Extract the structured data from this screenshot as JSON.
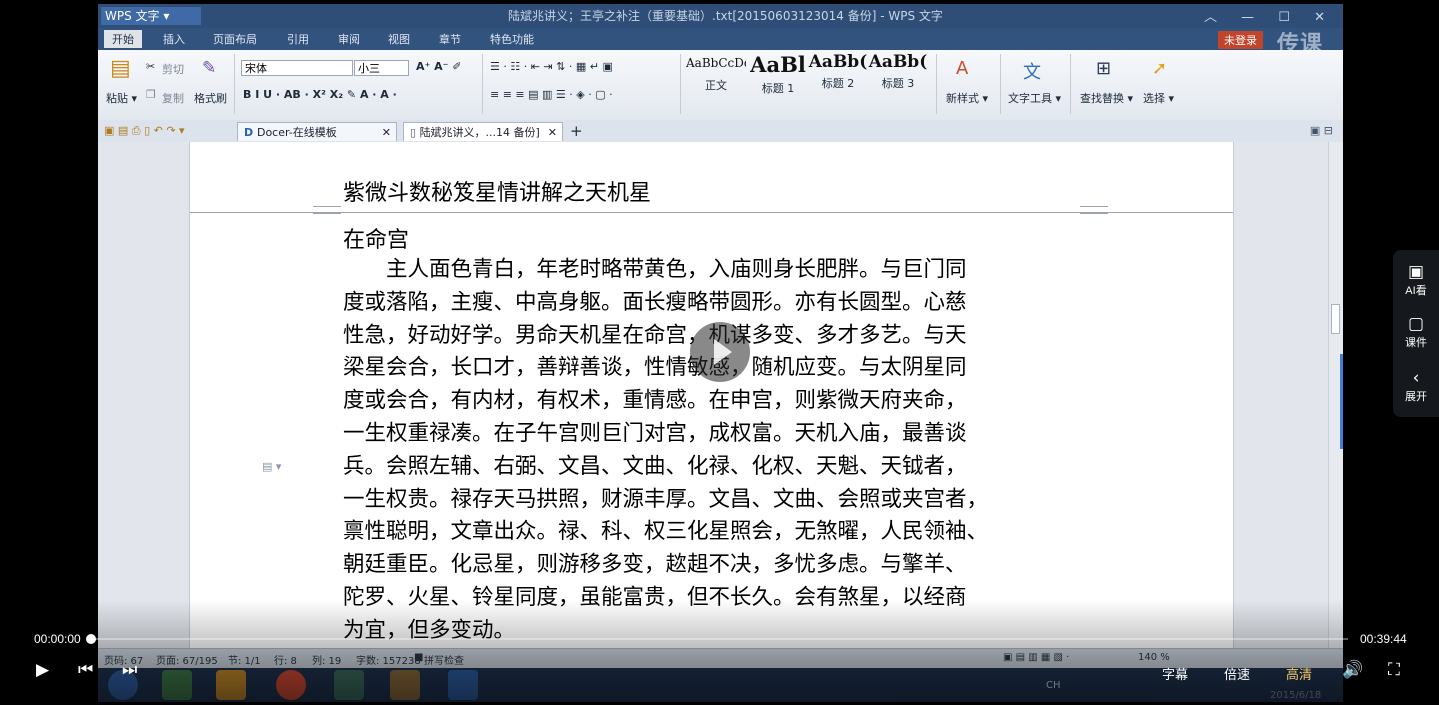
{
  "window": {
    "app_button": "WPS 文字 ▾",
    "title": "陆斌兆讲义；王亭之补注（重要基础）.txt[20150603123014 备份] - WPS 文字",
    "controls": "︿ — ☐ ✕"
  },
  "menu": {
    "items": [
      "开始",
      "插入",
      "页面布局",
      "引用",
      "审阅",
      "视图",
      "章节",
      "特色功能"
    ],
    "login": "未登录",
    "brand": "传课",
    "help": "? ▾"
  },
  "ribbon": {
    "paste": "粘贴 ▾",
    "cut": "剪切",
    "copy": "复制",
    "format_painter": "格式刷",
    "font_name": "宋体",
    "font_size": "小三",
    "styles": [
      {
        "sample": "AaBbCcDd",
        "label": "正文"
      },
      {
        "sample": "AaBl",
        "label": "标题 1"
      },
      {
        "sample": "AaBb(",
        "label": "标题 2"
      },
      {
        "sample": "AaBb(",
        "label": "标题 3"
      }
    ],
    "new_style": "新样式 ▾",
    "text_tools": "文字工具 ▾",
    "find_replace": "查找替换 ▾",
    "select": "选择 ▾"
  },
  "tabs": [
    {
      "label": "Docer-在线模板"
    },
    {
      "label": "陆斌兆讲义，...14 备份]"
    }
  ],
  "document": {
    "heading": "紫微斗数秘笈星情讲解之天机星",
    "subheading": "在命宫",
    "lines": [
      "　　主人面色青白，年老时略带黄色，入庙则身长肥胖。与巨门同",
      "度或落陷，主瘦、中高身躯。面长瘦略带圆形。亦有长圆型。心慈",
      "性急，好动好学。男命天机星在命宫，机谋多变、多才多艺。与天",
      "梁星会合，长口才，善辩善谈，性情敏感，随机应变。与太阴星同",
      "度或会合，有内材，有权术，重情感。在申宫，则紫微天府夹命，",
      "一生权重禄凑。在子午宫则巨门对宫，成权富。天机入庙，最善谈",
      "兵。会照左辅、右弼、文昌、文曲、化禄、化权、天魁、天钺者，",
      "一生权贵。禄存天马拱照，财源丰厚。文昌、文曲、会照或夹宫者，",
      "禀性聪明，文章出众。禄、科、权三化星照会，无煞曜，人民领袖、",
      "朝廷重臣。化忌星，则游移多变，趑趄不决，多忧多虑。与擎羊、",
      "陀罗、火星、铃星同度，虽能富贵，但不长久。会有煞星，以经商",
      "为宜，但多变动。"
    ]
  },
  "status": {
    "page_num": "页码: 67",
    "pages": "页面: 67/195",
    "section": "节: 1/1",
    "row": "行: 8",
    "col": "列: 19",
    "word_count": "字数: 157238",
    "spell_check": "拼写检查",
    "zoom": "140 %"
  },
  "player": {
    "current_time": "00:00:00",
    "total_time": "00:39:44",
    "progress": 0.0,
    "subtitles": "字幕",
    "speed": "倍速",
    "quality": "高清",
    "quality_color": "#f2c96a"
  },
  "side_panel": {
    "ai": "AI看",
    "courseware": "课件",
    "expand": "展开"
  },
  "taskbar": {
    "date": "2015/6/18",
    "ime": "CH"
  }
}
